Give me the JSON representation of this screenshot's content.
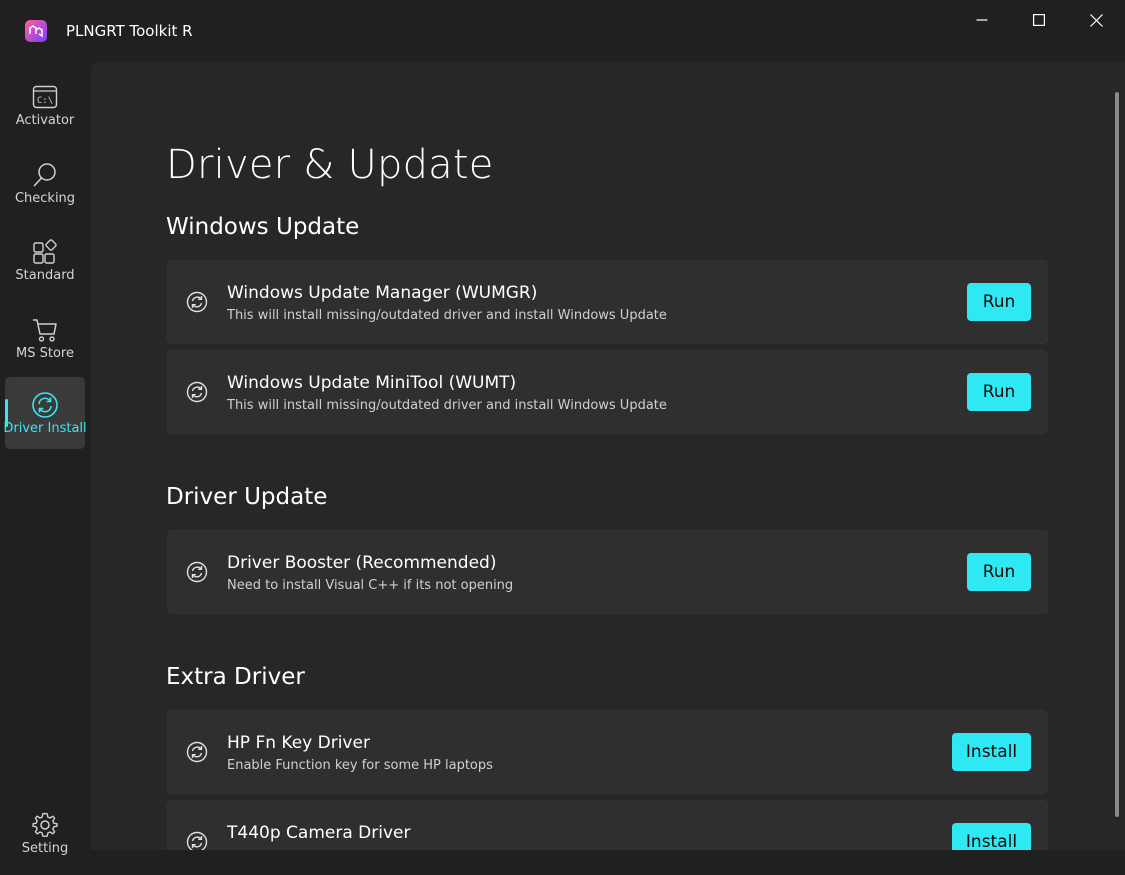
{
  "window": {
    "title": "PLNGRT Toolkit R"
  },
  "sidebar": {
    "items": [
      {
        "label": "Activator",
        "icon": "terminal-icon"
      },
      {
        "label": "Checking",
        "icon": "search-icon"
      },
      {
        "label": "Standard",
        "icon": "apps-icon"
      },
      {
        "label": "MS Store",
        "icon": "cart-icon"
      },
      {
        "label": "Driver Install",
        "icon": "sync-icon",
        "active": true
      }
    ],
    "footer": {
      "label": "Setting",
      "icon": "gear-icon"
    }
  },
  "page": {
    "title": "Driver & Update",
    "sections": [
      {
        "title": "Windows Update",
        "cards": [
          {
            "title": "Windows Update Manager (WUMGR)",
            "desc": "This will install missing/outdated driver and install Windows Update",
            "button": "Run"
          },
          {
            "title": "Windows Update MiniTool (WUMT)",
            "desc": "This will install missing/outdated driver and install Windows Update",
            "button": "Run"
          }
        ]
      },
      {
        "title": "Driver Update",
        "cards": [
          {
            "title": "Driver Booster (Recommended)",
            "desc": "Need to install Visual C++ if its not opening",
            "button": "Run"
          }
        ]
      },
      {
        "title": "Extra Driver",
        "cards": [
          {
            "title": "HP Fn Key Driver",
            "desc": "Enable Function key for some HP laptops",
            "button": "Install"
          },
          {
            "title": "T440p Camera Driver",
            "desc": "",
            "button": "Install"
          }
        ]
      }
    ]
  },
  "colors": {
    "accent": "#2ee8f4",
    "background": "#202020",
    "content": "#272727",
    "card": "#2f2f2f"
  }
}
